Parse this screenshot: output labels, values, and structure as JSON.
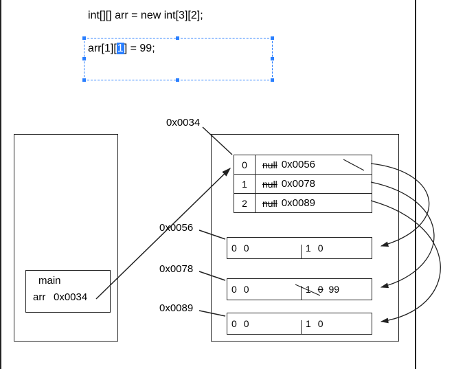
{
  "code": {
    "line1": "int[][] arr = new int[3][2];",
    "line2_prefix": "arr[1]",
    "line2_bracket_open": "[",
    "line2_highlight": "1",
    "line2_bracket_close": "]",
    "line2_suffix": " = 99;"
  },
  "stack": {
    "frame_name": "main",
    "var_name": "arr",
    "var_value": "0x0034"
  },
  "heap": {
    "outer_addr": "0x0034",
    "outer_rows": [
      {
        "index": "0",
        "old": "null",
        "addr": "0x0056"
      },
      {
        "index": "1",
        "old": "null",
        "addr": "0x0078"
      },
      {
        "index": "2",
        "old": "null",
        "addr": "0x0089"
      }
    ],
    "subarrays": [
      {
        "addr": "0x0056",
        "cells": [
          {
            "i": "0",
            "v": "0"
          },
          {
            "i": "1",
            "v": "0"
          }
        ]
      },
      {
        "addr": "0x0078",
        "cells": [
          {
            "i": "0",
            "v": "0"
          },
          {
            "i": "1",
            "v": "0",
            "override": "99"
          }
        ]
      },
      {
        "addr": "0x0089",
        "cells": [
          {
            "i": "0",
            "v": "0"
          },
          {
            "i": "1",
            "v": "0"
          }
        ]
      }
    ]
  },
  "chart_data": {
    "type": "table",
    "title": "Java 2D array memory diagram",
    "declaration": "int[][] arr = new int[3][2];",
    "assignment": "arr[1][1] = 99;",
    "stack_frame": {
      "name": "main",
      "vars": {
        "arr": "0x0034"
      }
    },
    "heap": {
      "0x0034": {
        "type": "int[][]",
        "elements": [
          "0x0056",
          "0x0078",
          "0x0089"
        ],
        "previous_elements": [
          "null",
          "null",
          "null"
        ]
      },
      "0x0056": {
        "type": "int[]",
        "elements": [
          0,
          0
        ]
      },
      "0x0078": {
        "type": "int[]",
        "elements": [
          0,
          99
        ],
        "previous_elements": [
          0,
          0
        ]
      },
      "0x0089": {
        "type": "int[]",
        "elements": [
          0,
          0
        ]
      }
    }
  }
}
